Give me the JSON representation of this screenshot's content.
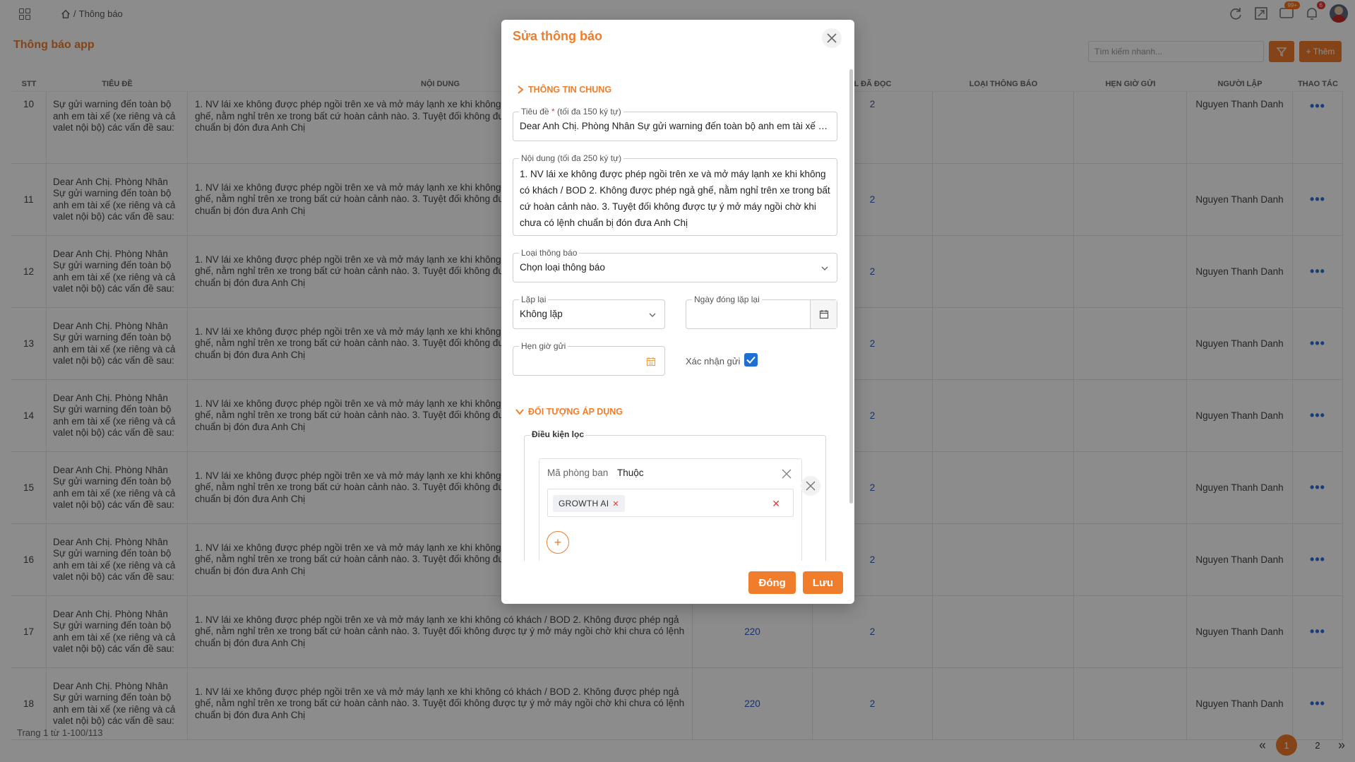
{
  "breadcrumb": {
    "separator": "/",
    "current": "Thông báo"
  },
  "page": {
    "title": "Thông báo app",
    "search_placeholder": "Tìm kiếm nhanh...",
    "add_label": "+ Thêm"
  },
  "badges": {
    "messages": "99+",
    "notifications": "6"
  },
  "table": {
    "headers": {
      "stt": "STT",
      "title": "TIÊU ĐỀ",
      "content": "NỘI DUNG",
      "sent": "",
      "read": "L ĐÃ ĐỌC",
      "type": "LOẠI THÔNG BÁO",
      "time": "HẸN GIỜ GỬI",
      "creator": "NGƯỜI LẬP",
      "action": "THAO TÁC"
    },
    "rows": [
      {
        "stt": "10",
        "title": "Sự gửi warning đến toàn bộ anh em tài xế (xe riêng và cả valet nội bộ) các vấn đề sau:",
        "content": "1. NV lái xe không được phép ngồi trên xe và mở máy lạnh xe khi không có khách / BOD 2. Không được phép ngả ghế, nằm nghỉ trên xe trong bất cứ hoàn cảnh nào. 3. Tuyệt đối không được tự ý mở máy ngồi chờ khi chưa có lệnh chuẩn bị đón đưa Anh Chị",
        "sent": "",
        "read": "2",
        "creator": "Nguyen Thanh Danh",
        "action": "•••"
      },
      {
        "stt": "11",
        "title": "Dear Anh Chị. Phòng Nhân Sự gửi warning đến toàn bộ anh em tài xế (xe riêng và cả valet nội bộ) các vấn đề sau:",
        "content": "1. NV lái xe không được phép ngồi trên xe và mở máy lạnh xe khi không có khách / BOD 2. Không được phép ngả ghế, nằm nghỉ trên xe trong bất cứ hoàn cảnh nào. 3. Tuyệt đối không được tự ý mở máy ngồi chờ khi chưa có lệnh chuẩn bị đón đưa Anh Chị",
        "sent": "",
        "read": "2",
        "creator": "Nguyen Thanh Danh",
        "action": "•••"
      },
      {
        "stt": "12",
        "title": "Dear Anh Chị. Phòng Nhân Sự gửi warning đến toàn bộ anh em tài xế (xe riêng và cả valet nội bộ) các vấn đề sau:",
        "content": "1. NV lái xe không được phép ngồi trên xe và mở máy lạnh xe khi không có khách / BOD 2. Không được phép ngả ghế, nằm nghỉ trên xe trong bất cứ hoàn cảnh nào. 3. Tuyệt đối không được tự ý mở máy ngồi chờ khi chưa có lệnh chuẩn bị đón đưa Anh Chị",
        "sent": "",
        "read": "2",
        "creator": "Nguyen Thanh Danh",
        "action": "•••"
      },
      {
        "stt": "13",
        "title": "Dear Anh Chị. Phòng Nhân Sự gửi warning đến toàn bộ anh em tài xế (xe riêng và cả valet nội bộ) các vấn đề sau:",
        "content": "1. NV lái xe không được phép ngồi trên xe và mở máy lạnh xe khi không có khách / BOD 2. Không được phép ngả ghế, nằm nghỉ trên xe trong bất cứ hoàn cảnh nào. 3. Tuyệt đối không được tự ý mở máy ngồi chờ khi chưa có lệnh chuẩn bị đón đưa Anh Chị",
        "sent": "",
        "read": "2",
        "creator": "Nguyen Thanh Danh",
        "action": "•••"
      },
      {
        "stt": "14",
        "title": "Dear Anh Chị. Phòng Nhân Sự gửi warning đến toàn bộ anh em tài xế (xe riêng và cả valet nội bộ) các vấn đề sau:",
        "content": "1. NV lái xe không được phép ngồi trên xe và mở máy lạnh xe khi không có khách / BOD 2. Không được phép ngả ghế, nằm nghỉ trên xe trong bất cứ hoàn cảnh nào. 3. Tuyệt đối không được tự ý mở máy ngồi chờ khi chưa có lệnh chuẩn bị đón đưa Anh Chị",
        "sent": "",
        "read": "2",
        "creator": "Nguyen Thanh Danh",
        "action": "•••"
      },
      {
        "stt": "15",
        "title": "Dear Anh Chị. Phòng Nhân Sự gửi warning đến toàn bộ anh em tài xế (xe riêng và cả valet nội bộ) các vấn đề sau:",
        "content": "1. NV lái xe không được phép ngồi trên xe và mở máy lạnh xe khi không có khách / BOD 2. Không được phép ngả ghế, nằm nghỉ trên xe trong bất cứ hoàn cảnh nào. 3. Tuyệt đối không được tự ý mở máy ngồi chờ khi chưa có lệnh chuẩn bị đón đưa Anh Chị",
        "sent": "",
        "read": "2",
        "creator": "Nguyen Thanh Danh",
        "action": "•••"
      },
      {
        "stt": "16",
        "title": "Dear Anh Chị. Phòng Nhân Sự gửi warning đến toàn bộ anh em tài xế (xe riêng và cả valet nội bộ) các vấn đề sau:",
        "content": "1. NV lái xe không được phép ngồi trên xe và mở máy lạnh xe khi không có khách / BOD 2. Không được phép ngả ghế, nằm nghỉ trên xe trong bất cứ hoàn cảnh nào. 3. Tuyệt đối không được tự ý mở máy ngồi chờ khi chưa có lệnh chuẩn bị đón đưa Anh Chị",
        "sent": "",
        "read": "2",
        "creator": "Nguyen Thanh Danh",
        "action": "•••"
      },
      {
        "stt": "17",
        "title": "Dear Anh Chị. Phòng Nhân Sự gửi warning đến toàn bộ anh em tài xế (xe riêng và cả valet nội bộ) các vấn đề sau:",
        "content": "1. NV lái xe không được phép ngồi trên xe và mở máy lạnh xe khi không có khách / BOD 2. Không được phép ngả ghế, nằm nghỉ trên xe trong bất cứ hoàn cảnh nào. 3. Tuyệt đối không được tự ý mở máy ngồi chờ khi chưa có lệnh chuẩn bị đón đưa Anh Chị",
        "sent": "220",
        "read": "2",
        "creator": "Nguyen Thanh Danh",
        "action": "•••"
      },
      {
        "stt": "18",
        "title": "Dear Anh Chị. Phòng Nhân Sự gửi warning đến toàn bộ anh em tài xế (xe riêng và cả valet nội bộ) các vấn đề sau:",
        "content": "1. NV lái xe không được phép ngồi trên xe và mở máy lạnh xe khi không có khách / BOD 2. Không được phép ngả ghế, nằm nghỉ trên xe trong bất cứ hoàn cảnh nào. 3. Tuyệt đối không được tự ý mở máy ngồi chờ khi chưa có lệnh chuẩn bị đón đưa Anh Chị",
        "sent": "220",
        "read": "2",
        "creator": "Nguyen Thanh Danh",
        "action": "•••"
      }
    ]
  },
  "pagination": {
    "summary": "Trang 1 từ 1-100/113",
    "pages": [
      "1",
      "2"
    ],
    "active": "1",
    "prev": "«",
    "next": "»"
  },
  "modal": {
    "title": "Sửa thông báo",
    "section_general": "THÔNG TIN CHUNG",
    "title_field": {
      "label": "Tiêu đề",
      "required_mark": "*",
      "hint": "(tối đa 150 ký tự)",
      "value": "Dear Anh Chị. Phòng Nhân Sự gửi warning đến toàn bộ anh em tài xế (xe riêng và cả valet nội bộ) các vấn đề sau:"
    },
    "content_field": {
      "label": "Nội dung (tối đa 250 ký tự)",
      "value": "1. NV lái xe không được phép ngồi trên xe và mở máy lạnh xe khi không có khách / BOD 2. Không được phép ngả ghế, nằm nghỉ trên xe trong bất cứ hoàn cảnh nào. 3. Tuyệt đối không được tự ý mở máy ngồi chờ khi chưa có lệnh chuẩn bị đón đưa Anh Chị"
    },
    "type_field": {
      "label": "Loại thông báo",
      "value": "Chọn loại thông báo"
    },
    "repeat_field": {
      "label": "Lặp lại",
      "value": "Không lặp"
    },
    "repeat_close_field": {
      "label": "Ngày đóng lặp lại",
      "value": ""
    },
    "schedule_field": {
      "label": "Hẹn giờ gửi",
      "value": ""
    },
    "confirm_label": "Xác nhận gửi",
    "confirm_checked": true,
    "section_target": "ĐỐI TƯỢNG ÁP DỤNG",
    "filter_label": "Điều kiện lọc",
    "condition": {
      "field": "Mã phòng ban",
      "operator": "Thuộc",
      "tags": [
        "GROWTH AI"
      ]
    },
    "buttons": {
      "close": "Đóng",
      "save": "Lưu"
    }
  },
  "colors": {
    "accent": "#f07d2b",
    "link": "#2f5cc4",
    "checkbox": "#1f6fd1"
  },
  "icons": [
    "grid-icon",
    "home-icon",
    "refresh-icon",
    "expand-icon",
    "chat-icon",
    "bell-icon",
    "filter-icon",
    "close-icon",
    "chevron-right-icon",
    "chevron-down-icon",
    "calendar-icon",
    "check-icon",
    "plus-icon"
  ]
}
